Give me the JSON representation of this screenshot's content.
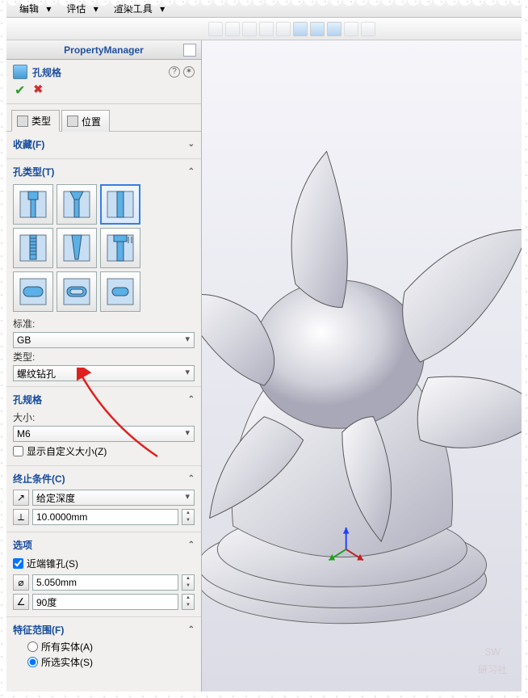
{
  "menubar": {
    "items": [
      "编辑",
      "评估",
      "渲染工具"
    ]
  },
  "pm": {
    "title": "PropertyManager"
  },
  "feature": {
    "title": "孔规格"
  },
  "tabs": {
    "type": "类型",
    "position": "位置"
  },
  "sections": {
    "favorites": "收藏(F)",
    "holeType": "孔类型(T)",
    "standardLabel": "标准:",
    "standardValue": "GB",
    "typeLabel": "类型:",
    "typeValue": "螺纹钻孔",
    "holeSpec": "孔规格",
    "sizeLabel": "大小:",
    "sizeValue": "M6",
    "customSizeChk": "显示自定义大小(Z)",
    "endCond": "终止条件(C)",
    "endCondValue": "给定深度",
    "depthValue": "10.0000mm",
    "options": "选项",
    "nearCountersinkChk": "近端锥孔(S)",
    "csDiameterValue": "5.050mm",
    "csAngleValue": "90度",
    "featScope": "特征范围(F)",
    "allBodies": "所有实体(A)",
    "selectedBodies": "所选实体(S)"
  },
  "watermark": {
    "line1": "SW",
    "line2": "研习社"
  }
}
